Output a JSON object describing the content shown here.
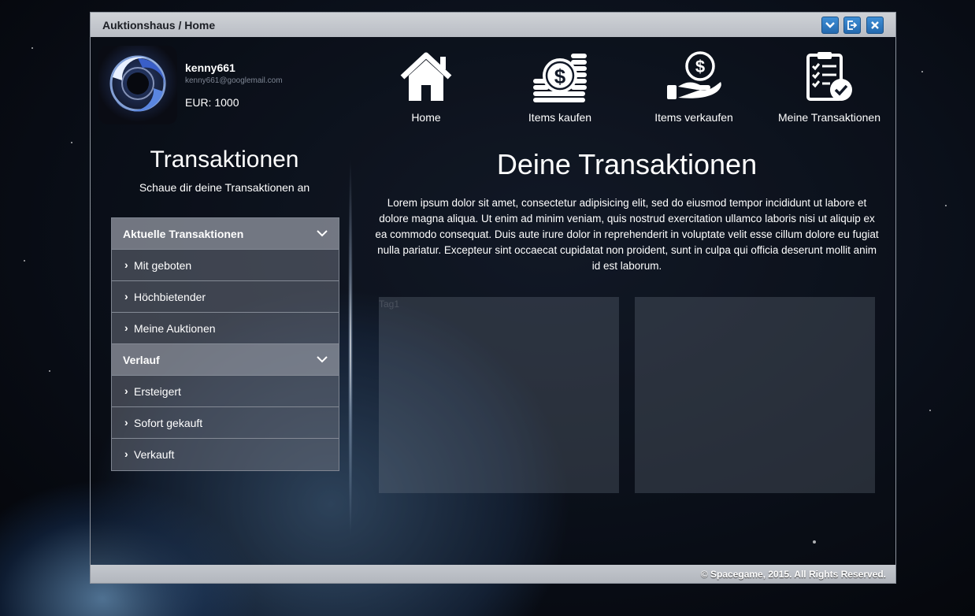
{
  "window": {
    "title": "Auktionshaus / Home",
    "controls": [
      "chevron-down-icon",
      "logout-icon",
      "close-icon"
    ]
  },
  "user": {
    "name": "kenny661",
    "email": "kenny661@googlemail.com",
    "balance": "EUR: 1000"
  },
  "nav": {
    "items": [
      {
        "label": "Home",
        "icon": "home-icon"
      },
      {
        "label": "Items kaufen",
        "icon": "coins-icon"
      },
      {
        "label": "Items verkaufen",
        "icon": "hand-money-icon"
      },
      {
        "label": "Meine Transaktionen",
        "icon": "clipboard-check-icon"
      }
    ]
  },
  "sidebar": {
    "title": "Transaktionen",
    "subtitle": "Schaue dir deine Transaktionen an",
    "groups": [
      {
        "label": "Aktuelle Transaktionen",
        "items": [
          "Mit geboten",
          "Höchbietender",
          "Meine Auktionen"
        ]
      },
      {
        "label": "Verlauf",
        "items": [
          "Ersteigert",
          "Sofort gekauft",
          "Verkauft"
        ]
      }
    ]
  },
  "main": {
    "title": "Deine Transaktionen",
    "text": "Lorem ipsum dolor sit amet, consectetur adipisicing elit, sed do eiusmod tempor incididunt ut labore et dolore magna aliqua. Ut enim ad minim veniam, quis nostrud exercitation ullamco laboris nisi ut aliquip ex ea commodo consequat. Duis aute irure dolor in reprehenderit in voluptate velit esse cillum dolore eu fugiat nulla pariatur. Excepteur sint occaecat cupidatat non proident, sunt in culpa qui officia deserunt mollit anim id est laborum.",
    "panels": [
      {
        "label": "Tag1"
      },
      {
        "label": ""
      }
    ]
  },
  "footer": {
    "text": "© Spacegame, 2015. All Rights Reserved."
  },
  "colors": {
    "accent": "#2f7cc4",
    "titlebar": "#c4c8ce"
  }
}
